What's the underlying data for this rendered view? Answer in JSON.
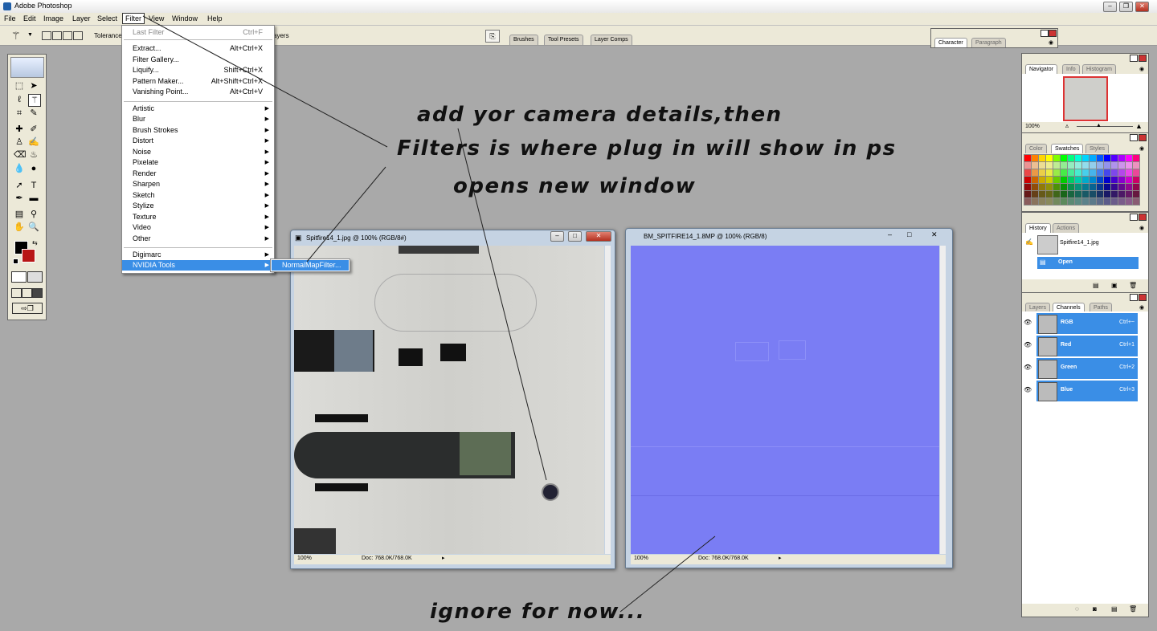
{
  "app": {
    "title": "Adobe Photoshop"
  },
  "menubar": [
    "File",
    "Edit",
    "Image",
    "Layer",
    "Select",
    "Filter",
    "View",
    "Window",
    "Help"
  ],
  "options_bar": {
    "tolerance_label": "Tolerance",
    "layers_label": "ayers",
    "well_tabs": [
      "Brushes",
      "Tool Presets",
      "Layer Comps"
    ]
  },
  "character_panel": {
    "tabs": [
      "Character",
      "Paragraph"
    ]
  },
  "filter_menu": {
    "group1": [
      {
        "label": "Last Filter",
        "shortcut": "Ctrl+F"
      }
    ],
    "group2": [
      {
        "label": "Extract...",
        "shortcut": "Alt+Ctrl+X"
      },
      {
        "label": "Filter Gallery...",
        "shortcut": ""
      },
      {
        "label": "Liquify...",
        "shortcut": "Shift+Ctrl+X"
      },
      {
        "label": "Pattern Maker...",
        "shortcut": "Alt+Shift+Ctrl+X"
      },
      {
        "label": "Vanishing Point...",
        "shortcut": "Alt+Ctrl+V"
      }
    ],
    "group3": [
      "Artistic",
      "Blur",
      "Brush Strokes",
      "Distort",
      "Noise",
      "Pixelate",
      "Render",
      "Sharpen",
      "Sketch",
      "Stylize",
      "Texture",
      "Video",
      "Other"
    ],
    "group4": [
      "Digimarc",
      "NVIDIA Tools"
    ],
    "submenu_item": "NormalMapFilter..."
  },
  "doc1": {
    "title": "Spitfire14_1.jpg @ 100% (RGB/8#)",
    "zoom": "100%",
    "doc_size": "Doc: 768.0K/768.0K"
  },
  "doc2": {
    "title": "BM_SPITFIRE14_1.8MP @ 100% (RGB/8)",
    "zoom": "100%",
    "doc_size": "Doc: 768.0K/768.0K"
  },
  "navigator": {
    "tabs": [
      "Navigator",
      "Info",
      "Histogram"
    ],
    "zoom": "100%"
  },
  "swatches": {
    "tabs": [
      "Color",
      "Swatches",
      "Styles"
    ]
  },
  "history": {
    "tabs": [
      "History",
      "Actions"
    ],
    "snapshot": "Spitfire14_1.jpg",
    "state": "Open"
  },
  "channels": {
    "tabs": [
      "Layers",
      "Channels",
      "Paths"
    ],
    "rows": [
      {
        "name": "RGB",
        "shortcut": "Ctrl+~"
      },
      {
        "name": "Red",
        "shortcut": "Ctrl+1"
      },
      {
        "name": "Green",
        "shortcut": "Ctrl+2"
      },
      {
        "name": "Blue",
        "shortcut": "Ctrl+3"
      }
    ]
  },
  "annotations": {
    "line1": "add yor camera details,then",
    "line2": "Filters is where plug in will show in ps",
    "line3": "opens new window",
    "line4": "ignore for now..."
  },
  "colors": {
    "selection": "#3a8ee6",
    "normal_map": "#7a7df4",
    "menu_bg": "#ece9d8",
    "workspace": "#a9a9a9"
  }
}
